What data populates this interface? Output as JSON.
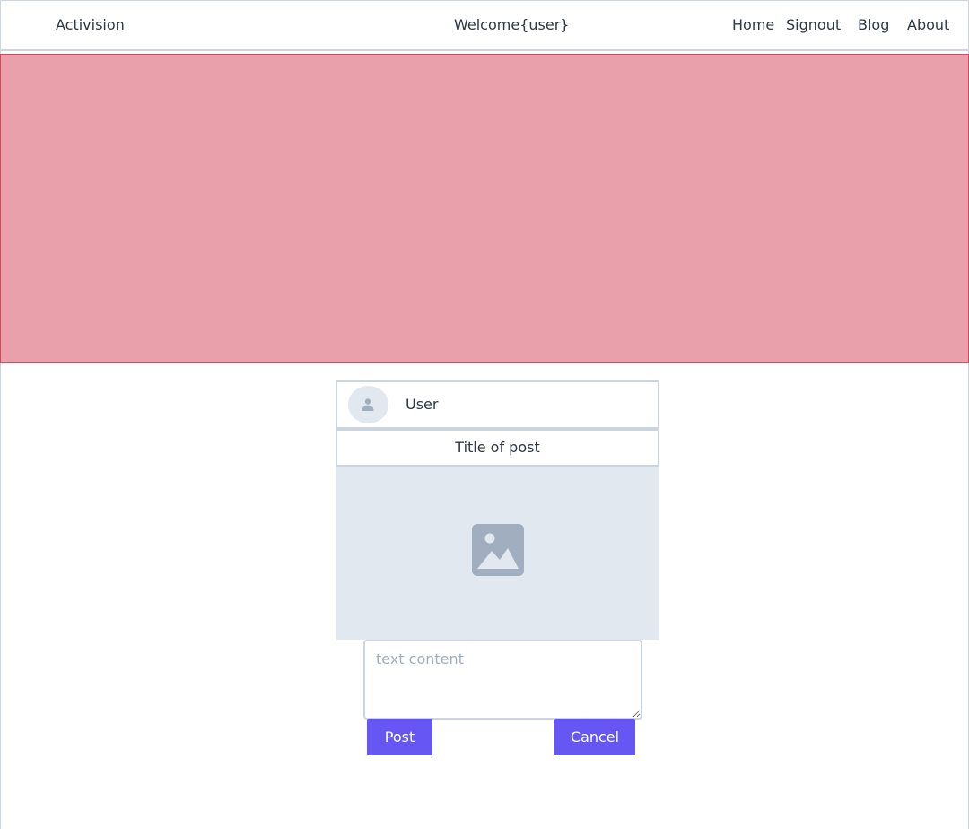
{
  "navbar": {
    "brand": "Activision",
    "welcome": "Welcome{user}",
    "links": {
      "home": "Home",
      "signout": "Signout",
      "blog": "Blog",
      "about": "About"
    }
  },
  "banner": {
    "color": "#e9a0aa",
    "border_color": "#d9455a"
  },
  "post": {
    "user": "User",
    "avatar_icon": "user-icon",
    "title": "Title of post",
    "image_icon": "image-placeholder-icon",
    "text_placeholder": "text content",
    "text_value": "",
    "post_label": "Post",
    "cancel_label": "Cancel"
  },
  "colors": {
    "accent": "#6657f5",
    "border": "#cbd5e0",
    "placeholder_bg": "#e2e8f0",
    "text": "#2d3748"
  }
}
